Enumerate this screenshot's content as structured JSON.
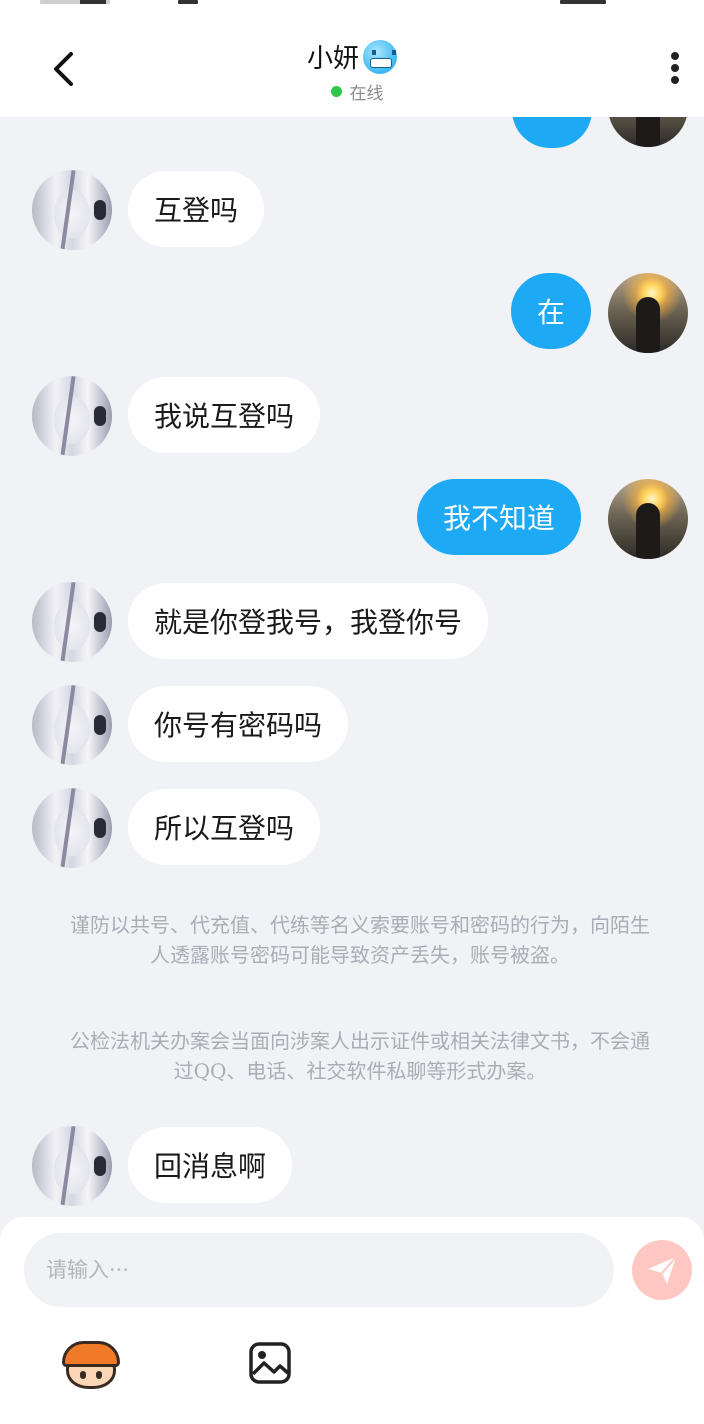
{
  "header": {
    "back_icon": "chevron-left-icon",
    "title": "小妍",
    "title_emoji": "cold-face-emoji",
    "status": "在线",
    "status_color": "#2ec84a",
    "more_icon": "more-vertical-icon"
  },
  "messages": [
    {
      "side": "in",
      "text": "互登吗"
    },
    {
      "side": "out",
      "text": "在"
    },
    {
      "side": "in",
      "text": "我说互登吗"
    },
    {
      "side": "out",
      "text": "我不知道"
    },
    {
      "side": "in",
      "text": "就是你登我号，我登你号"
    },
    {
      "side": "in",
      "text": "你号有密码吗"
    },
    {
      "side": "in",
      "text": "所以互登吗"
    },
    {
      "side": "in",
      "text": "回消息啊"
    }
  ],
  "notices": {
    "line1": "谨防以共号、代充值、代练等名义索要账号和密码的行为，向陌生人透露账号密码可能导致资产丢失，账号被盗。",
    "line2": "公检法机关办案会当面向涉案人出示证件或相关法律文书，不会通过QQ、电话、社交软件私聊等形式办案。"
  },
  "composer": {
    "placeholder": "请输入···",
    "send_icon": "send-icon",
    "mascot_icon": "mascot-sticker-icon",
    "image_icon": "image-icon"
  },
  "colors": {
    "outgoing_bubble": "#1ea9f5",
    "incoming_bubble": "#ffffff",
    "background": "#f1f2f5",
    "send_button": "#ffc7c2"
  }
}
